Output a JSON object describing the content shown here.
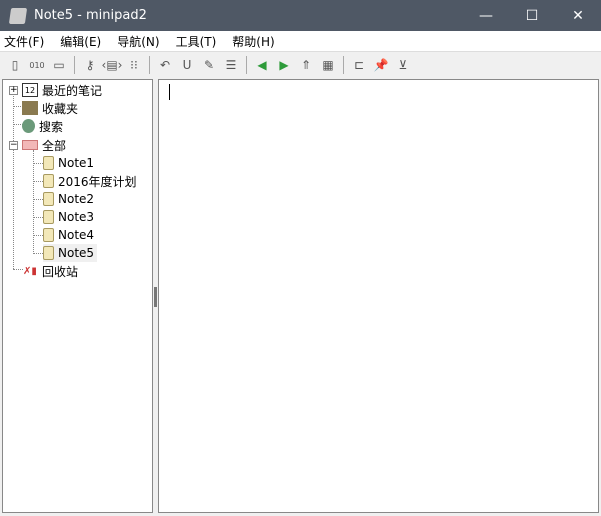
{
  "window": {
    "title": "Note5 - minipad2",
    "minimize": "—",
    "maximize": "☐",
    "close": "✕"
  },
  "menu": [
    "文件(F)",
    "编辑(E)",
    "导航(N)",
    "工具(T)",
    "帮助(H)"
  ],
  "toolbar": [
    {
      "icon": "new-note-icon",
      "glyph": "▯"
    },
    {
      "icon": "binary-note-icon",
      "glyph": "010"
    },
    {
      "icon": "new-folder-icon",
      "glyph": "▭"
    },
    {
      "sep": true
    },
    {
      "icon": "add-link-icon",
      "glyph": "⚷"
    },
    {
      "icon": "html-tag-icon",
      "glyph": "‹▤›"
    },
    {
      "icon": "list-view-icon",
      "glyph": "⁝⁝"
    },
    {
      "sep": true
    },
    {
      "icon": "undo-icon",
      "glyph": "↶"
    },
    {
      "icon": "underline-icon",
      "glyph": "U"
    },
    {
      "icon": "highlight-pen-icon",
      "glyph": "✎"
    },
    {
      "icon": "insert-line-icon",
      "glyph": "☰"
    },
    {
      "sep": true
    },
    {
      "icon": "back-arrow-icon",
      "glyph": "◀"
    },
    {
      "icon": "forward-arrow-icon",
      "glyph": "▶"
    },
    {
      "icon": "up-level-icon",
      "glyph": "⇑"
    },
    {
      "icon": "favorites-icon",
      "glyph": "▦"
    },
    {
      "sep": true
    },
    {
      "icon": "tree-view-icon",
      "glyph": "⊏"
    },
    {
      "icon": "pin-icon",
      "glyph": "📌"
    },
    {
      "icon": "save-down-icon",
      "glyph": "⊻"
    }
  ],
  "tree": {
    "recent": "最近的笔记",
    "favorites": "收藏夹",
    "search": "搜索",
    "all": "全部",
    "notes": [
      "Note1",
      "2016年度计划",
      "Note2",
      "Note3",
      "Note4",
      "Note5"
    ],
    "recycle": "回收站",
    "selected": "Note5"
  },
  "colors": {
    "titlebar": "#4f5865",
    "folder": "#e8a0a0",
    "note": "#f3e8b8",
    "nav_green": "#2e9b3a"
  }
}
